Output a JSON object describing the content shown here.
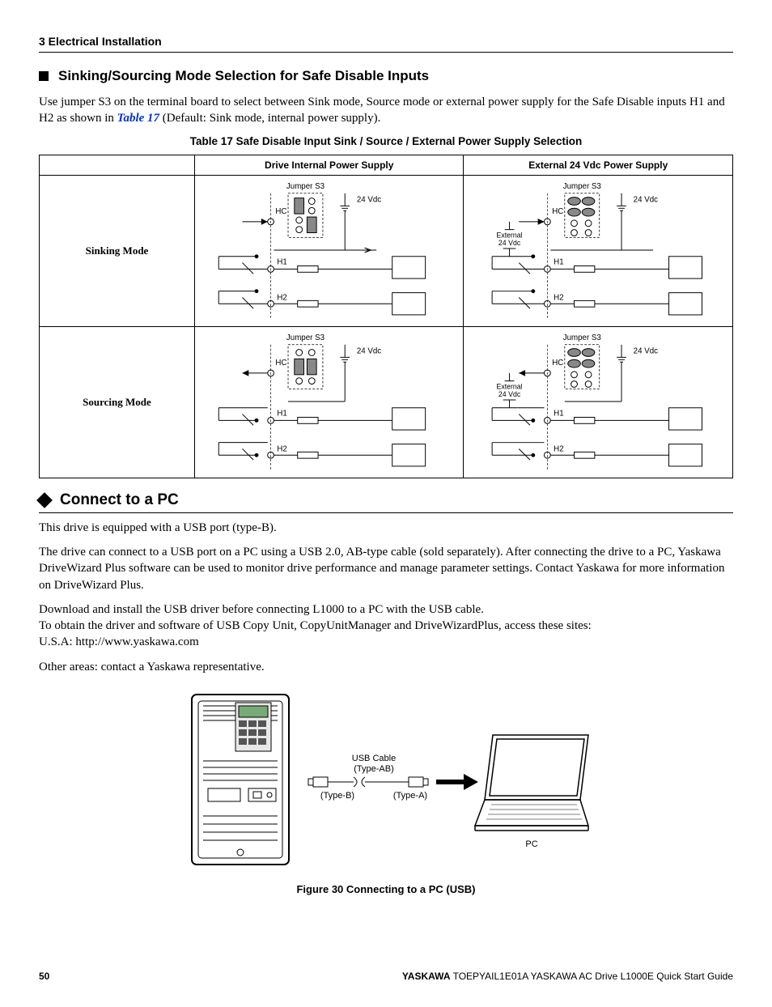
{
  "chapter_header": "3  Electrical Installation",
  "section_sink_source": {
    "title": "Sinking/Sourcing Mode Selection for Safe Disable Inputs",
    "para_pre": "Use jumper S3 on the terminal board to select between Sink mode, Source mode or external power supply for the Safe Disable inputs H1 and H2 as shown in ",
    "xref": "Table 17",
    "para_post": " (Default: Sink mode, internal power supply)."
  },
  "table17": {
    "caption": "Table 17  Safe Disable Input Sink / Source / External Power Supply Selection",
    "col_blank": "",
    "col1": "Drive Internal Power Supply",
    "col2": "External 24 Vdc Power Supply",
    "row1": "Sinking Mode",
    "row2": "Sourcing Mode",
    "diagram_labels": {
      "jumper": "Jumper S3",
      "vdc": "24 Vdc",
      "hc": "HC",
      "h1": "H1",
      "h2": "H2",
      "ext1": "External",
      "ext2": "24 Vdc"
    }
  },
  "section_pc": {
    "title": "Connect to a PC",
    "p1": "This drive is equipped with a USB port (type-B).",
    "p2": "The drive can connect to a USB port on a PC using a USB 2.0, AB-type cable (sold separately). After connecting the drive to a PC, Yaskawa DriveWizard Plus software can be used to monitor drive performance and manage parameter settings. Contact Yaskawa for more information on DriveWizard Plus.",
    "p3a": "Download and install the USB driver before connecting L1000 to a PC with the USB cable.",
    "p3b": "To obtain the driver and software of USB Copy Unit, CopyUnitManager and DriveWizardPlus, access these sites:",
    "p3c": "U.S.A: http://www.yaskawa.com",
    "p4": "Other areas: contact a Yaskawa representative."
  },
  "figure30": {
    "caption": "Figure 30  Connecting to a PC (USB)",
    "labels": {
      "cable1": "USB Cable",
      "cable2": "(Type-AB)",
      "typeB": "(Type-B)",
      "typeA": "(Type-A)",
      "pc": "PC"
    }
  },
  "footer": {
    "page": "50",
    "brand": "YASKAWA",
    "doc": " TOEPYAIL1E01A YASKAWA AC Drive L1000E Quick Start Guide"
  }
}
